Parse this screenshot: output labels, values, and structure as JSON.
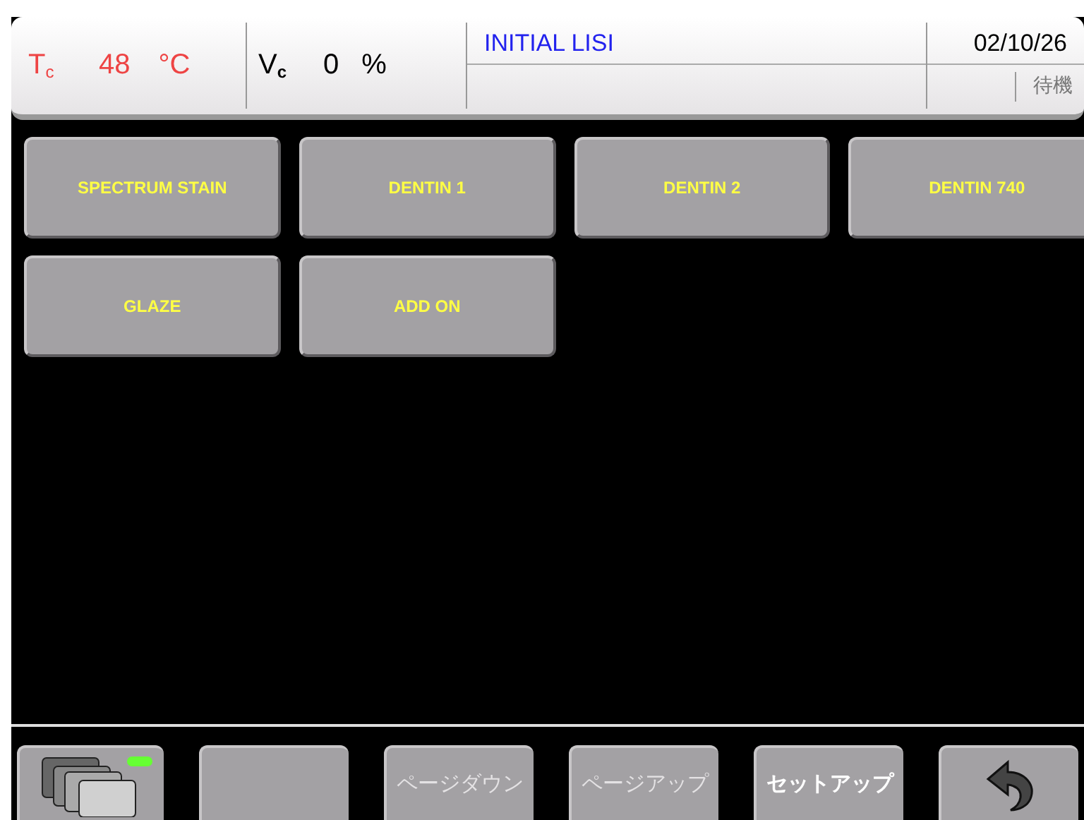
{
  "header": {
    "temperature": {
      "label": "T$_{c}$",
      "value": "48",
      "unit": "°C"
    },
    "vacuum": {
      "label": "V$_{c}$",
      "value": "0",
      "unit": "%"
    },
    "program_name": "INITIAL LISI",
    "date": "02/10/26",
    "status": "待機"
  },
  "programs": [
    {
      "label": "SPECTRUM STAIN"
    },
    {
      "label": "DENTIN 1"
    },
    {
      "label": "DENTIN 2"
    },
    {
      "label": "DENTIN 740"
    },
    {
      "label": "GLAZE"
    },
    {
      "label": "ADD ON"
    }
  ],
  "toolbar": [
    {
      "kind": "folders",
      "indicator_on": true
    },
    {
      "kind": "blank"
    },
    {
      "kind": "text",
      "label": "ページダウン",
      "disabled": true
    },
    {
      "kind": "text",
      "label": "ページアップ",
      "disabled": true
    },
    {
      "kind": "text",
      "label": "セットアップ",
      "disabled": false
    },
    {
      "kind": "back"
    }
  ]
}
